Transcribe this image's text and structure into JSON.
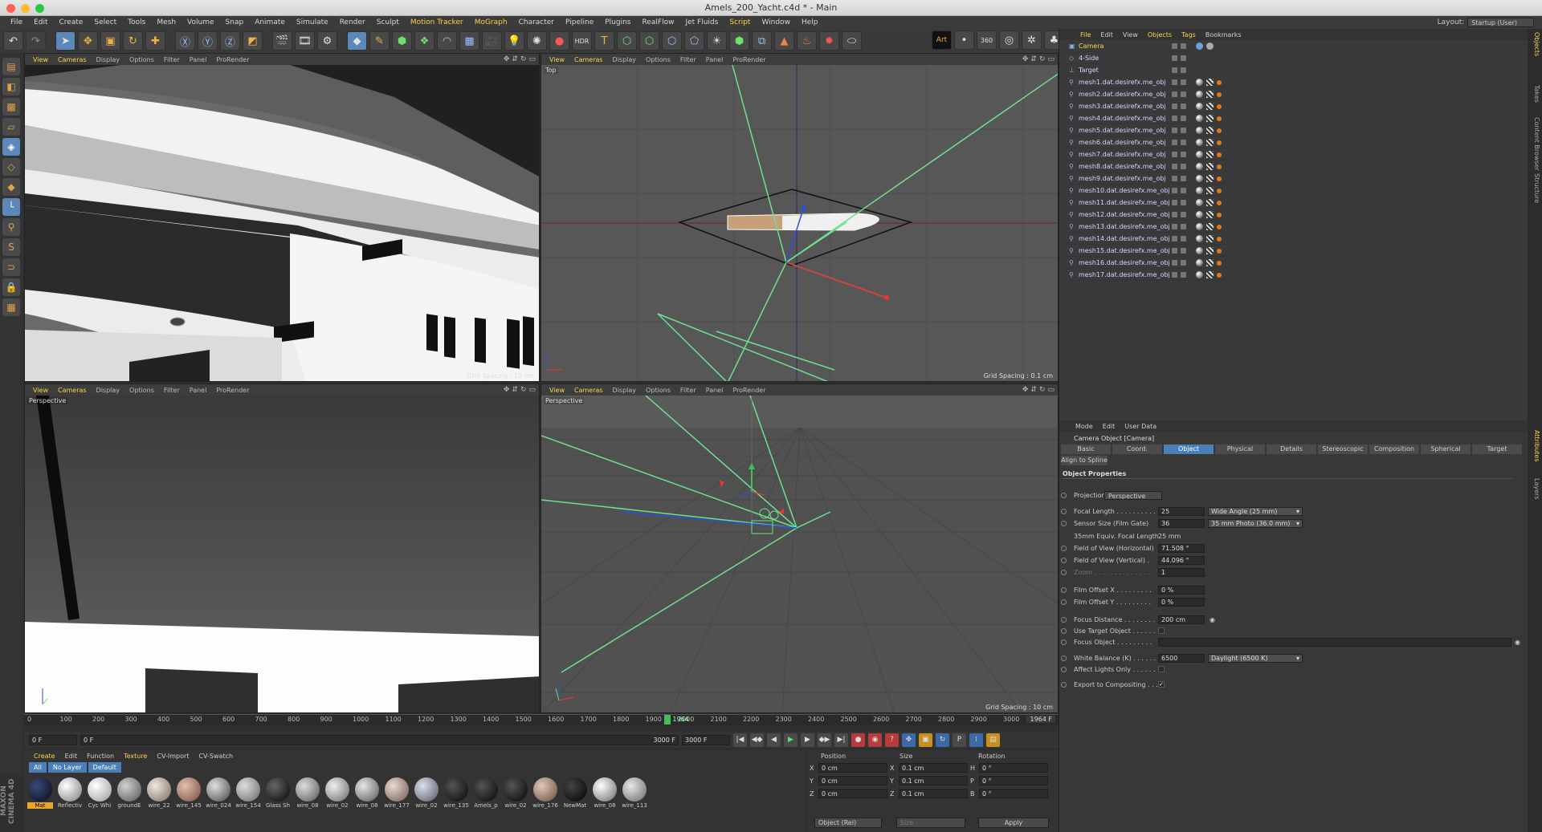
{
  "window": {
    "title": "Amels_200_Yacht.c4d * - Main"
  },
  "menu": [
    "File",
    "Edit",
    "Create",
    "Select",
    "Tools",
    "Mesh",
    "Volume",
    "Snap",
    "Animate",
    "Simulate",
    "Render",
    "Sculpt",
    "Motion Tracker",
    "MoGraph",
    "Character",
    "Pipeline",
    "Plugins",
    "RealFlow",
    "Jet Fluids",
    "Script",
    "Window",
    "Help"
  ],
  "menu_highlighted": [
    "Motion Tracker",
    "MoGraph",
    "Script"
  ],
  "layout": {
    "label": "Layout:",
    "value": "Startup (User)"
  },
  "toolbar_icons": [
    "undo-icon",
    "redo-icon",
    "select-icon",
    "move-icon",
    "scale-icon",
    "rotate-icon",
    "live-select-icon",
    "x-axis-icon",
    "y-axis-icon",
    "z-axis-icon",
    "coord-system-icon",
    "render-view-icon",
    "render-pv-icon",
    "render-settings-icon",
    "cube-icon",
    "pen-icon",
    "subdivision-icon",
    "cloner-icon",
    "deformer-icon",
    "floor-icon",
    "camera-icon",
    "light-icon",
    "hair-icon",
    "material-icon",
    "hdri-icon",
    "cap-icon",
    "tag-icon",
    "art-icon",
    "viewport-360-icon",
    "target-icon"
  ],
  "viewports": [
    {
      "menu": [
        "View",
        "Cameras",
        "Display",
        "Options",
        "Filter",
        "Panel",
        "ProRender"
      ],
      "label": "",
      "grid_spacing": "Grid Spacing : 10 cm"
    },
    {
      "menu": [
        "View",
        "Cameras",
        "Display",
        "Options",
        "Filter",
        "Panel",
        "ProRender"
      ],
      "label": "Top",
      "grid_spacing": "Grid Spacing : 0.1 cm"
    },
    {
      "menu": [
        "View",
        "Cameras",
        "Display",
        "Options",
        "Filter",
        "Panel",
        "ProRender"
      ],
      "label": "Perspective",
      "grid_spacing": "Grid Spacing : 10 cm"
    },
    {
      "menu": [
        "View",
        "Cameras",
        "Display",
        "Options",
        "Filter",
        "Panel",
        "ProRender"
      ],
      "label": "Perspective",
      "grid_spacing": "Grid Spacing : 10 cm"
    }
  ],
  "timeline": {
    "ticks": [
      "0",
      "100",
      "200",
      "300",
      "400",
      "500",
      "600",
      "700",
      "800",
      "900",
      "1000",
      "1100",
      "1200",
      "1300",
      "1400",
      "1500",
      "1600",
      "1700",
      "1800",
      "1900",
      "2000",
      "2100",
      "2200",
      "2300",
      "2400",
      "2500",
      "2600",
      "2700",
      "2800",
      "2900",
      "3000"
    ],
    "current": "1964",
    "end_field": "1964 F"
  },
  "playback": {
    "start": "0 F",
    "start2": "0 F",
    "end": "3000 F",
    "end2": "3000 F"
  },
  "materials": {
    "menu": [
      "Create",
      "Edit",
      "Function",
      "Texture",
      "CV-Import",
      "CV-Swatch"
    ],
    "menu_highlighted": [
      "Create",
      "Texture"
    ],
    "filters": [
      "All",
      "No Layer",
      "Default"
    ],
    "items": [
      {
        "name": "Mat",
        "color": "radial-gradient(circle at 35% 35%,#3a4a7a,#0a0a15)"
      },
      {
        "name": "Reflectiv",
        "color": "radial-gradient(circle at 35% 35%,#ffffff,#7a7a7a)"
      },
      {
        "name": "Cyc Whi",
        "color": "radial-gradient(circle at 35% 35%,#ffffff,#999)"
      },
      {
        "name": "groundE",
        "color": "radial-gradient(circle at 35% 35%,#cfcfcf,#555)"
      },
      {
        "name": "wire_22",
        "color": "radial-gradient(circle at 35% 35%,#f0e8e0,#7a6a5a)"
      },
      {
        "name": "wire_145",
        "color": "radial-gradient(circle at 35% 35%,#e0c0b0,#7a4a3a)"
      },
      {
        "name": "wire_024",
        "color": "radial-gradient(circle at 35% 35%,#e0e0e0,#444)"
      },
      {
        "name": "wire_154",
        "color": "radial-gradient(circle at 35% 35%,#ddd,#666)"
      },
      {
        "name": "Glass Sh",
        "color": "radial-gradient(circle at 35% 35%,#666,#050505)"
      },
      {
        "name": "wire_08",
        "color": "radial-gradient(circle at 35% 35%,#ddd,#555)"
      },
      {
        "name": "wire_02",
        "color": "radial-gradient(circle at 35% 35%,#eee,#666)"
      },
      {
        "name": "wire_08",
        "color": "radial-gradient(circle at 35% 35%,#e5e5e5,#555)"
      },
      {
        "name": "wire_177",
        "color": "radial-gradient(circle at 35% 35%,#e8d8d0,#6a5a50)"
      },
      {
        "name": "wire_02",
        "color": "radial-gradient(circle at 35% 35%,#d8e0e8,#556)"
      },
      {
        "name": "wire_135",
        "color": "radial-gradient(circle at 35% 35%,#555,#050505)"
      },
      {
        "name": "Amels_p",
        "color": "radial-gradient(circle at 35% 35%,#555,#050505)"
      },
      {
        "name": "wire_02",
        "color": "radial-gradient(circle at 35% 35%,#555,#050505)"
      },
      {
        "name": "wire_176",
        "color": "radial-gradient(circle at 35% 35%,#e0c8b8,#6a4a3a)"
      },
      {
        "name": "NewMat",
        "color": "radial-gradient(circle at 35% 35%,#444,#020202)"
      },
      {
        "name": "wire_08",
        "color": "radial-gradient(circle at 35% 35%,#fff,#666)"
      },
      {
        "name": "wire_113",
        "color": "radial-gradient(circle at 35% 35%,#e8e8e8,#666)"
      }
    ]
  },
  "coords": {
    "headers": [
      "Position",
      "Size",
      "Rotation"
    ],
    "rows": [
      {
        "axis": "X",
        "pos": "0 cm",
        "size_axis": "X",
        "size": "0.1 cm",
        "rot_axis": "H",
        "rot": "0 °"
      },
      {
        "axis": "Y",
        "pos": "0 cm",
        "size_axis": "Y",
        "size": "0.1 cm",
        "rot_axis": "P",
        "rot": "0 °"
      },
      {
        "axis": "Z",
        "pos": "0 cm",
        "size_axis": "Z",
        "size": "0.1 cm",
        "rot_axis": "B",
        "rot": "0 °"
      }
    ],
    "mode": "Object (Rel)",
    "size_mode": "Size",
    "apply": "Apply"
  },
  "objects": {
    "menu": [
      "File",
      "Edit",
      "View",
      "Objects",
      "Tags",
      "Bookmarks"
    ],
    "menu_highlighted": [
      "File",
      "Objects",
      "Tags"
    ],
    "items": [
      {
        "name": "Camera",
        "selected": true
      },
      {
        "name": "4-Side",
        "selected": false
      },
      {
        "name": "Target",
        "selected": false
      },
      {
        "name": "mesh1.dat.desirefx.me_obj",
        "selected": false
      },
      {
        "name": "mesh2.dat.desirefx.me_obj",
        "selected": false
      },
      {
        "name": "mesh3.dat.desirefx.me_obj",
        "selected": false
      },
      {
        "name": "mesh4.dat.desirefx.me_obj",
        "selected": false
      },
      {
        "name": "mesh5.dat.desirefx.me_obj",
        "selected": false
      },
      {
        "name": "mesh6.dat.desirefx.me_obj",
        "selected": false
      },
      {
        "name": "mesh7.dat.desirefx.me_obj",
        "selected": false
      },
      {
        "name": "mesh8.dat.desirefx.me_obj",
        "selected": false
      },
      {
        "name": "mesh9.dat.desirefx.me_obj",
        "selected": false
      },
      {
        "name": "mesh10.dat.desirefx.me_obj",
        "selected": false
      },
      {
        "name": "mesh11.dat.desirefx.me_obj",
        "selected": false
      },
      {
        "name": "mesh12.dat.desirefx.me_obj",
        "selected": false
      },
      {
        "name": "mesh13.dat.desirefx.me_obj",
        "selected": false
      },
      {
        "name": "mesh14.dat.desirefx.me_obj",
        "selected": false
      },
      {
        "name": "mesh15.dat.desirefx.me_obj",
        "selected": false
      },
      {
        "name": "mesh16.dat.desirefx.me_obj",
        "selected": false
      },
      {
        "name": "mesh17.dat.desirefx.me_obj",
        "selected": false
      }
    ]
  },
  "attributes": {
    "menu": [
      "Mode",
      "Edit",
      "User Data"
    ],
    "title": "Camera Object [Camera]",
    "tabs": [
      "Basic",
      "Coord.",
      "Object",
      "Physical",
      "Details",
      "Stereoscopic",
      "Composition",
      "Spherical",
      "Target"
    ],
    "selected_tab": "Object",
    "align_btn": "Align to Spline",
    "section": "Object Properties",
    "projection_label": "Projection",
    "projection_value": "Perspective",
    "props": [
      {
        "label": "Focal Length . . . . . . . . . .",
        "value": "25",
        "dd": "Wide Angle (25 mm)",
        "dim": false
      },
      {
        "label": "Sensor Size (Film Gate)",
        "value": "36",
        "dd": "35 mm Photo (36.0 mm)",
        "dim": false
      },
      {
        "label": "35mm Equiv. Focal Length:",
        "value": "25 mm",
        "plain": true,
        "dim": false
      },
      {
        "label": "Field of View (Horizontal)",
        "value": "71.508 °",
        "dim": false
      },
      {
        "label": "Field of View (Vertical) .",
        "value": "44.096 °",
        "dim": false
      },
      {
        "label": "Zoom . . . . . . . . . . . . . .",
        "value": "1",
        "dim": true
      },
      {
        "label": "Film Offset X . . . . . . . . .",
        "value": "0 %",
        "dim": false
      },
      {
        "label": "Film Offset Y . . . . . . . . .",
        "value": "0 %",
        "dim": false
      },
      {
        "label": "Focus Distance . . . . . . . .",
        "value": "200 cm",
        "dim": false
      },
      {
        "label": "Use Target Object . . . . . .",
        "check": "",
        "dim": false
      },
      {
        "label": "Focus Object . . . . . . . . .",
        "wide": true,
        "dim": false
      },
      {
        "label": "White Balance (K) . . . . . .",
        "value": "6500",
        "dd": "Daylight (6500 K)",
        "dim": false
      },
      {
        "label": "Affect Lights Only . . . . . .",
        "check": "",
        "dim": false
      },
      {
        "label": "Export to Compositing . . .",
        "check": "✓",
        "dim": false
      }
    ]
  },
  "right_tabs": [
    "Objects",
    "Takes",
    "Content Browser",
    "Structure",
    "Attributes",
    "Layers"
  ],
  "logo": "MAXON CINEMA 4D"
}
